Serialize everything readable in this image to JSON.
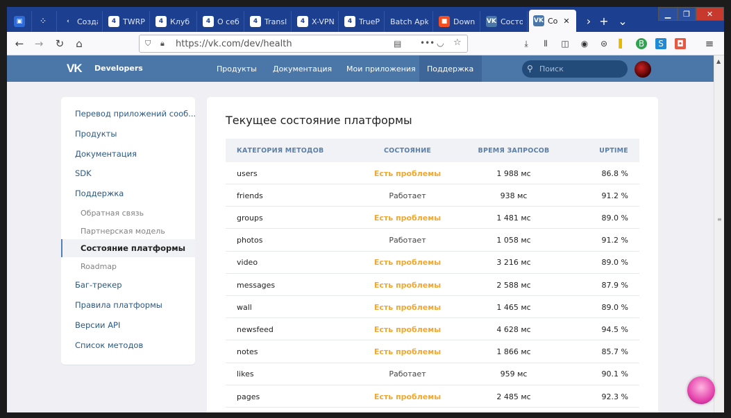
{
  "browser": {
    "tabs": [
      {
        "label": "",
        "fav_color": "#2f6bd6",
        "fav_glyph": "▣"
      },
      {
        "label": "",
        "fav_color": "#1c3f8f",
        "fav_glyph": "⁘"
      },
      {
        "label": "Созда",
        "fav_color": "#1c3f8f",
        "fav_glyph": "‹"
      },
      {
        "label": "TWRP",
        "fav_color": "#ffffff",
        "fav_glyph": "4"
      },
      {
        "label": "Клуб",
        "fav_color": "#ffffff",
        "fav_glyph": "4"
      },
      {
        "label": "О себе",
        "fav_color": "#ffffff",
        "fav_glyph": "4"
      },
      {
        "label": "Transl",
        "fav_color": "#ffffff",
        "fav_glyph": "4"
      },
      {
        "label": "X-VPN",
        "fav_color": "#ffffff",
        "fav_glyph": "4"
      },
      {
        "label": "TrueP",
        "fav_color": "#ffffff",
        "fav_glyph": "4"
      },
      {
        "label": "Batch Apk",
        "fav_color": "#1c3f8f",
        "fav_glyph": ""
      },
      {
        "label": "Down",
        "fav_color": "#f25022",
        "fav_glyph": "■"
      },
      {
        "label": "Состо",
        "fav_color": "#4a76a8",
        "fav_glyph": "VK"
      },
      {
        "label": "Со",
        "fav_color": "#4a76a8",
        "fav_glyph": "VK"
      }
    ],
    "url": "https://vk.com/dev/health"
  },
  "vk": {
    "brand": "Developers",
    "logo": "VK",
    "menu": [
      "Продукты",
      "Документация",
      "Мои приложения",
      "Поддержка"
    ],
    "search_placeholder": "Поиск"
  },
  "sidenav": [
    {
      "label": "Перевод приложений сооб...",
      "kind": "top"
    },
    {
      "label": "Продукты",
      "kind": "top"
    },
    {
      "label": "Документация",
      "kind": "top"
    },
    {
      "label": "SDK",
      "kind": "top"
    },
    {
      "label": "Поддержка",
      "kind": "top"
    },
    {
      "label": "Обратная связь",
      "kind": "sub"
    },
    {
      "label": "Партнерская модель",
      "kind": "sub"
    },
    {
      "label": "Состояние платформы",
      "kind": "current"
    },
    {
      "label": "Roadmap",
      "kind": "sub"
    },
    {
      "label": "Баг-трекер",
      "kind": "top"
    },
    {
      "label": "Правила платформы",
      "kind": "top"
    },
    {
      "label": "Версии API",
      "kind": "top"
    },
    {
      "label": "Список методов",
      "kind": "top"
    }
  ],
  "page": {
    "title": "Текущее состояние платформы",
    "columns": [
      "КАТЕГОРИЯ МЕТОДОВ",
      "СОСТОЯНИЕ",
      "ВРЕМЯ ЗАПРОСОВ",
      "UPTIME"
    ],
    "rows": [
      {
        "method": "users",
        "status": "Есть проблемы",
        "bad": true,
        "time": "1 988 мс",
        "uptime": "86.8 %"
      },
      {
        "method": "friends",
        "status": "Работает",
        "bad": false,
        "time": "938 мс",
        "uptime": "91.2 %"
      },
      {
        "method": "groups",
        "status": "Есть проблемы",
        "bad": true,
        "time": "1 481 мс",
        "uptime": "89.0 %"
      },
      {
        "method": "photos",
        "status": "Работает",
        "bad": false,
        "time": "1 058 мс",
        "uptime": "91.2 %"
      },
      {
        "method": "video",
        "status": "Есть проблемы",
        "bad": true,
        "time": "3 216 мс",
        "uptime": "89.0 %"
      },
      {
        "method": "messages",
        "status": "Есть проблемы",
        "bad": true,
        "time": "2 588 мс",
        "uptime": "87.9 %"
      },
      {
        "method": "wall",
        "status": "Есть проблемы",
        "bad": true,
        "time": "1 465 мс",
        "uptime": "89.0 %"
      },
      {
        "method": "newsfeed",
        "status": "Есть проблемы",
        "bad": true,
        "time": "4 628 мс",
        "uptime": "94.5 %"
      },
      {
        "method": "notes",
        "status": "Есть проблемы",
        "bad": true,
        "time": "1 866 мс",
        "uptime": "85.7 %"
      },
      {
        "method": "likes",
        "status": "Работает",
        "bad": false,
        "time": "959 мс",
        "uptime": "90.1 %"
      },
      {
        "method": "pages",
        "status": "Есть проблемы",
        "bad": true,
        "time": "2 485 мс",
        "uptime": "92.3 %"
      }
    ]
  },
  "colors": {
    "vk_blue": "#4a76a8",
    "problem": "#f0a830",
    "link": "#2a5885",
    "tabbar": "#1c3f8f"
  }
}
